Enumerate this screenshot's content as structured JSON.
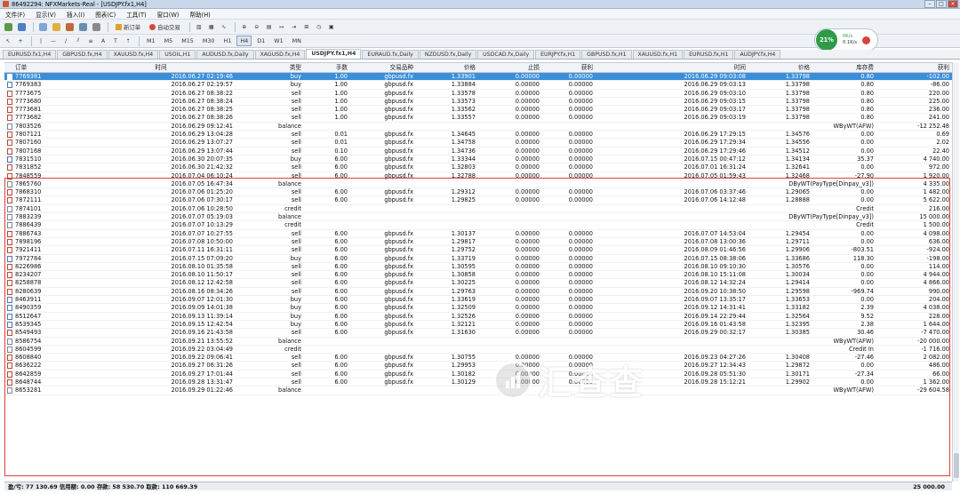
{
  "window": {
    "title": "86492294: NFXMarkets-Real - [USDJPY.fx1,H4]"
  },
  "menu": [
    "文件(F)",
    "显示(V)",
    "插入(I)",
    "图表(C)",
    "工具(T)",
    "窗口(W)",
    "帮助(H)"
  ],
  "toolbar": {
    "new_order": "新订单",
    "autotrade": "自动交易"
  },
  "timeframes": [
    "M1",
    "M5",
    "M15",
    "M30",
    "H1",
    "H4",
    "D1",
    "W1",
    "MN"
  ],
  "gauge": {
    "percent": "21%",
    "up": "0K/s",
    "down": "0.1K/s"
  },
  "tabs": [
    "EURUSD.fx1,H4",
    "GBPUSD.fx,H4",
    "XAUUSD.fx,H4",
    "USOIL,H1",
    "AUDUSD.fx,Daily",
    "XAGUSD.fx,H4",
    "USDJPY.fx1,H4",
    "EURAUD.fx,Daily",
    "NZDUSD.fx,Daily",
    "USDCAD.fx,Daily",
    "EURJPY.fx,H1",
    "GBPUSD.fx,H1",
    "XAUUSD.fx,H1",
    "EURUSD.fx,H1",
    "AUDJPY.fx,H4"
  ],
  "active_tab": "USDJPY.fx1,H4",
  "columns": [
    "订单",
    "时间",
    "类型",
    "手数",
    "交易品种",
    "价格",
    "止损",
    "获利",
    "时间",
    "价格",
    "库存费",
    "获利"
  ],
  "rows": [
    [
      "7769381",
      "2016.06.27 02:19:46",
      "buy",
      "1.00",
      "gbpusd.fx",
      "1.33901",
      "0.00000",
      "0.00000",
      "2016.06.29 09:03:08",
      "1.33798",
      "0.80",
      "-102.00"
    ],
    [
      "7769383",
      "2016.06.27 02:19:57",
      "buy",
      "1.00",
      "gbpusd.fx",
      "1.33884",
      "0.00000",
      "0.00000",
      "2016.06.29 09:03:13",
      "1.33798",
      "0.80",
      "-86.00"
    ],
    [
      "7773675",
      "2016.06.27 08:38:22",
      "sell",
      "1.00",
      "gbpusd.fx",
      "1.33578",
      "0.00000",
      "0.00000",
      "2016.06.29 09:03:10",
      "1.33798",
      "0.80",
      "220.00"
    ],
    [
      "7773680",
      "2016.06.27 08:38:24",
      "sell",
      "1.00",
      "gbpusd.fx",
      "1.33573",
      "0.00000",
      "0.00000",
      "2016.06.29 09:03:15",
      "1.33798",
      "0.80",
      "225.00"
    ],
    [
      "7773681",
      "2016.06.27 08:38:25",
      "sell",
      "1.00",
      "gbpusd.fx",
      "1.33562",
      "0.00000",
      "0.00000",
      "2016.06.29 09:03:17",
      "1.33798",
      "0.80",
      "236.00"
    ],
    [
      "7773682",
      "2016.06.27 08:38:26",
      "sell",
      "1.00",
      "gbpusd.fx",
      "1.33557",
      "0.00000",
      "0.00000",
      "2016.06.29 09:03:19",
      "1.33798",
      "0.80",
      "241.00"
    ],
    [
      "7803526",
      "2016.06.29 09:12:41",
      "balance",
      "",
      "",
      "",
      "",
      "",
      "",
      "",
      "WByWT(AFW)",
      "-12 252.48"
    ],
    [
      "7807121",
      "2016.06.29 13:04:28",
      "sell",
      "0.01",
      "gbpusd.fx",
      "1.34645",
      "0.00000",
      "0.00000",
      "2016.06.29 17:29:15",
      "1.34576",
      "0.00",
      "0.69"
    ],
    [
      "7807160",
      "2016.06.29 13:07:27",
      "sell",
      "0.01",
      "gbpusd.fx",
      "1.34758",
      "0.00000",
      "0.00000",
      "2016.06.29 17:29:34",
      "1.34556",
      "0.00",
      "2.02"
    ],
    [
      "7807168",
      "2016.06.29 13:07:44",
      "sell",
      "0.10",
      "gbpusd.fx",
      "1.34736",
      "0.00000",
      "0.00000",
      "2016.06.29 17:29:46",
      "1.34512",
      "0.00",
      "22.40"
    ],
    [
      "7831510",
      "2016.06.30 20:07:35",
      "buy",
      "6.00",
      "gbpusd.fx",
      "1.33344",
      "0.00000",
      "0.00000",
      "2016.07.15 00:47:12",
      "1.34134",
      "35.37",
      "4 740.00"
    ],
    [
      "7831852",
      "2016.06.30 21:42:32",
      "sell",
      "6.00",
      "gbpusd.fx",
      "1.32803",
      "0.00000",
      "0.00000",
      "2016.07.01 16:31:24",
      "1.32641",
      "0.00",
      "972.00"
    ],
    [
      "7848559",
      "2016.07.04 06:10:24",
      "sell",
      "6.00",
      "gbpusd.fx",
      "1.32788",
      "0.00000",
      "0.00000",
      "2016.07.05 01:59:43",
      "1.32468",
      "-27.90",
      "1 920.00"
    ],
    [
      "7865760",
      "2016.07.05 16:47:34",
      "balance",
      "",
      "",
      "",
      "",
      "",
      "",
      "",
      "DByWT(PayType[Dinpay_v3])",
      "4 335.00"
    ],
    [
      "7868310",
      "2016.07.06 01:25:20",
      "sell",
      "6.00",
      "gbpusd.fx",
      "1.29312",
      "0.00000",
      "0.00000",
      "2016.07.06 03:37:46",
      "1.29065",
      "0.00",
      "1 482.00"
    ],
    [
      "7872111",
      "2016.07.06 07:30:17",
      "sell",
      "6.00",
      "gbpusd.fx",
      "1.29825",
      "0.00000",
      "0.00000",
      "2016.07.06 14:12:48",
      "1.28888",
      "0.00",
      "5 622.00"
    ],
    [
      "7874101",
      "2016.07.06 10:28:50",
      "credit",
      "",
      "",
      "",
      "",
      "",
      "",
      "",
      "Credit",
      "216.00"
    ],
    [
      "7883239",
      "2016.07.07 05:19:03",
      "balance",
      "",
      "",
      "",
      "",
      "",
      "",
      "",
      "DByWT(PayType[Dinpay_v3])",
      "15 000.00"
    ],
    [
      "7886439",
      "2016.07.07 10:13:29",
      "credit",
      "",
      "",
      "",
      "",
      "",
      "",
      "",
      "Credit",
      "1 500.00"
    ],
    [
      "7886743",
      "2016.07.07 10:27:55",
      "sell",
      "6.00",
      "gbpusd.fx",
      "1.30137",
      "0.00000",
      "0.00000",
      "2016.07.07 14:53:04",
      "1.29454",
      "0.00",
      "4 098.00"
    ],
    [
      "7898196",
      "2016.07.08 10:50:00",
      "sell",
      "6.00",
      "gbpusd.fx",
      "1.29817",
      "0.00000",
      "0.00000",
      "2016.07.08 13:00:36",
      "1.29711",
      "0.00",
      "636.00"
    ],
    [
      "7921411",
      "2016.07.11 16:31:11",
      "sell",
      "6.00",
      "gbpusd.fx",
      "1.29752",
      "0.00000",
      "0.00000",
      "2016.08.09 01:46:56",
      "1.29906",
      "-803.51",
      "-924.00"
    ],
    [
      "7972784",
      "2016.07.15 07:09:20",
      "buy",
      "6.00",
      "gbpusd.fx",
      "1.33719",
      "0.00000",
      "0.00000",
      "2016.07.15 08:38:06",
      "1.33686",
      "118.30",
      "-198.00"
    ],
    [
      "8226986",
      "2016.08.10 01:35:58",
      "sell",
      "6.00",
      "gbpusd.fx",
      "1.30595",
      "0.00000",
      "0.00000",
      "2016.08.10 09:10:30",
      "1.30576",
      "0.00",
      "114.00"
    ],
    [
      "8234207",
      "2016.08.10 11:50:17",
      "sell",
      "6.00",
      "gbpusd.fx",
      "1.30858",
      "0.00000",
      "0.00000",
      "2016.08.10 15:11:08",
      "1.30034",
      "0.00",
      "4 944.00"
    ],
    [
      "8258878",
      "2016.08.12 12:42:58",
      "sell",
      "6.00",
      "gbpusd.fx",
      "1.30225",
      "0.00000",
      "0.00000",
      "2016.08.12 14:32:24",
      "1.29414",
      "0.00",
      "4 866.00"
    ],
    [
      "8280639",
      "2016.08.16 08:34:26",
      "sell",
      "6.00",
      "gbpusd.fx",
      "1.29763",
      "0.00000",
      "0.00000",
      "2016.09.20 10:38:50",
      "1.29598",
      "-969.74",
      "990.00"
    ],
    [
      "8463911",
      "2016.09.07 12:01:30",
      "buy",
      "6.00",
      "gbpusd.fx",
      "1.33619",
      "0.00000",
      "0.00000",
      "2016.09.07 13:35:17",
      "1.33653",
      "0.00",
      "204.00"
    ],
    [
      "8490359",
      "2016.09.09 14:01:38",
      "buy",
      "6.00",
      "gbpusd.fx",
      "1.32509",
      "0.00000",
      "0.00000",
      "2016.09.12 14:31:41",
      "1.33182",
      "2.39",
      "4 038.00"
    ],
    [
      "8512647",
      "2016.09.13 11:39:14",
      "buy",
      "6.00",
      "gbpusd.fx",
      "1.32526",
      "0.00000",
      "0.00000",
      "2016.09.14 22:29:44",
      "1.32564",
      "9.52",
      "228.00"
    ],
    [
      "8539345",
      "2016.09.15 12:42:54",
      "buy",
      "6.00",
      "gbpusd.fx",
      "1.32121",
      "0.00000",
      "0.00000",
      "2016.09.16 01:43:58",
      "1.32395",
      "2.38",
      "1 644.00"
    ],
    [
      "8549493",
      "2016.09.16 21:43:58",
      "sell",
      "6.00",
      "gbpusd.fx",
      "1.31630",
      "0.00000",
      "0.00000",
      "2016.09.29 00:32:17",
      "1.30385",
      "30.46",
      "-7 470.00"
    ],
    [
      "8586754",
      "2016.09.21 13:55:52",
      "balance",
      "",
      "",
      "",
      "",
      "",
      "",
      "",
      "WByWT(AFW)",
      "-20 000.00"
    ],
    [
      "8604599",
      "2016.09.22 03:04:49",
      "credit",
      "",
      "",
      "",
      "",
      "",
      "",
      "",
      "Credit In",
      "-1 716.00"
    ],
    [
      "8608840",
      "2016.09.22 09:06:41",
      "sell",
      "6.00",
      "gbpusd.fx",
      "1.30755",
      "0.00000",
      "0.00000",
      "2016.09.23 04:27:26",
      "1.30408",
      "-27.46",
      "2 082.00"
    ],
    [
      "8636222",
      "2016.09.27 06:31:26",
      "sell",
      "6.00",
      "gbpusd.fx",
      "1.29953",
      "0.00000",
      "0.00000",
      "2016.09.27 12:34:43",
      "1.29872",
      "0.00",
      "486.00"
    ],
    [
      "8642859",
      "2016.09.27 17:01:44",
      "sell",
      "6.00",
      "gbpusd.fx",
      "1.30182",
      "0.00000",
      "0.00000",
      "2016.09.28 05:51:30",
      "1.30171",
      "-27.34",
      "66.00"
    ],
    [
      "8648744",
      "2016.09.28 13:31:47",
      "sell",
      "6.00",
      "gbpusd.fx",
      "1.30129",
      "0.00000",
      "0.00000",
      "2016.09.28 15:12:21",
      "1.29902",
      "0.00",
      "1 362.00"
    ],
    [
      "8653281",
      "2016.09.29 01:22:46",
      "balance",
      "",
      "",
      "",
      "",
      "",
      "",
      "",
      "WByWT(AFW)",
      "-29 604.58"
    ]
  ],
  "status": {
    "summary": "盈/亏: 77 130.69  信用额: 0.00  存款: 58 530.70  取款: 110 669.39",
    "total": "25 000.00"
  },
  "watermark": {
    "text": "汇查查"
  },
  "colors": {
    "selection": "#3b8fd9",
    "highlight_border": "#d9423d",
    "gauge": "#2f9a47"
  }
}
